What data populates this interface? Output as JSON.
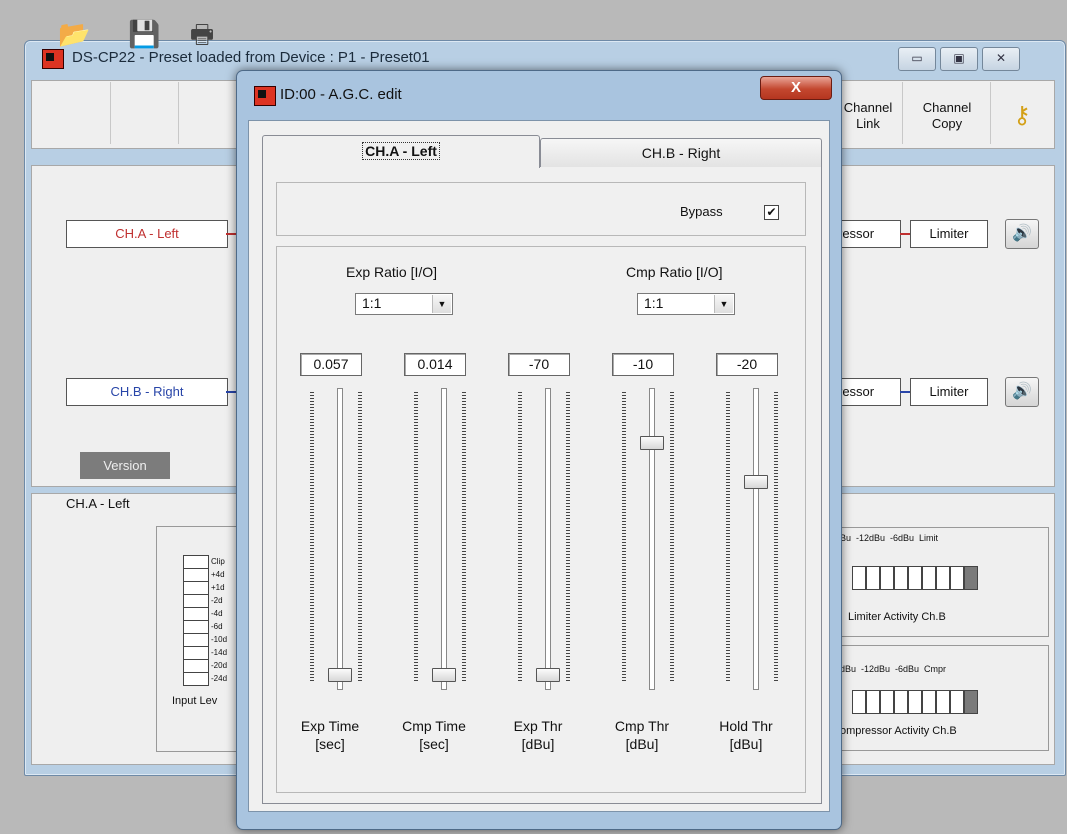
{
  "main_window": {
    "title": "DS-CP22 - Preset loaded from Device : P1 - Preset01",
    "controls": {
      "minimize": "▭",
      "maximize": "▣",
      "close": "✕"
    },
    "toolbar": {
      "channel_link_label": "Channel\nLink",
      "channel_copy_label": "Channel\nCopy"
    },
    "routing": {
      "ch_a_label": "CH.A - Left",
      "ch_b_label": "CH.B - Right",
      "compressor_a": "ressor",
      "compressor_b": "ressor",
      "limiter_a": "Limiter",
      "limiter_b": "Limiter",
      "version_button": "Version"
    },
    "status": {
      "legend": "CH.A - Left",
      "input_level_label": "Input Lev",
      "input_scale": [
        "Clip",
        "+4d",
        "+1d",
        "-2d",
        "-4d",
        "-6d",
        "-10d",
        "-14d",
        "-20d",
        "-24d"
      ],
      "limiter_scale": "Bu  -12dBu  -6dBu  Limit",
      "limiter_caption": "Limiter Activity Ch.B",
      "compressor_scale": "dBu  -12dBu  -6dBu  Cmpr",
      "compressor_caption": "ompressor Activity Ch.B"
    }
  },
  "dialog": {
    "title": "ID:00 - A.G.C. edit",
    "close_glyph": "X",
    "tabs": [
      {
        "label": "CH.A - Left",
        "selected": true
      },
      {
        "label": "CH.B - Right",
        "selected": false
      }
    ],
    "bypass": {
      "label": "Bypass",
      "checked": true,
      "mark": "✔"
    },
    "exp_ratio": {
      "label": "Exp Ratio [I/O]",
      "value": "1:1"
    },
    "cmp_ratio": {
      "label": "Cmp Ratio [I/O]",
      "value": "1:1"
    },
    "sliders": [
      {
        "id": "exp-time",
        "value": "0.057",
        "label_line1": "Exp Time",
        "label_line2": "[sec]",
        "level": 0.0
      },
      {
        "id": "cmp-time",
        "value": "0.014",
        "label_line1": "Cmp Time",
        "label_line2": "[sec]",
        "level": 0.0
      },
      {
        "id": "exp-thr",
        "value": "-70",
        "label_line1": "Exp Thr",
        "label_line2": "[dBu]",
        "level": 0.0
      },
      {
        "id": "cmp-thr",
        "value": "-10",
        "label_line1": "Cmp Thr",
        "label_line2": "[dBu]",
        "level": 0.83
      },
      {
        "id": "hold-thr",
        "value": "-20",
        "label_line1": "Hold Thr",
        "label_line2": "[dBu]",
        "level": 0.69
      }
    ]
  }
}
